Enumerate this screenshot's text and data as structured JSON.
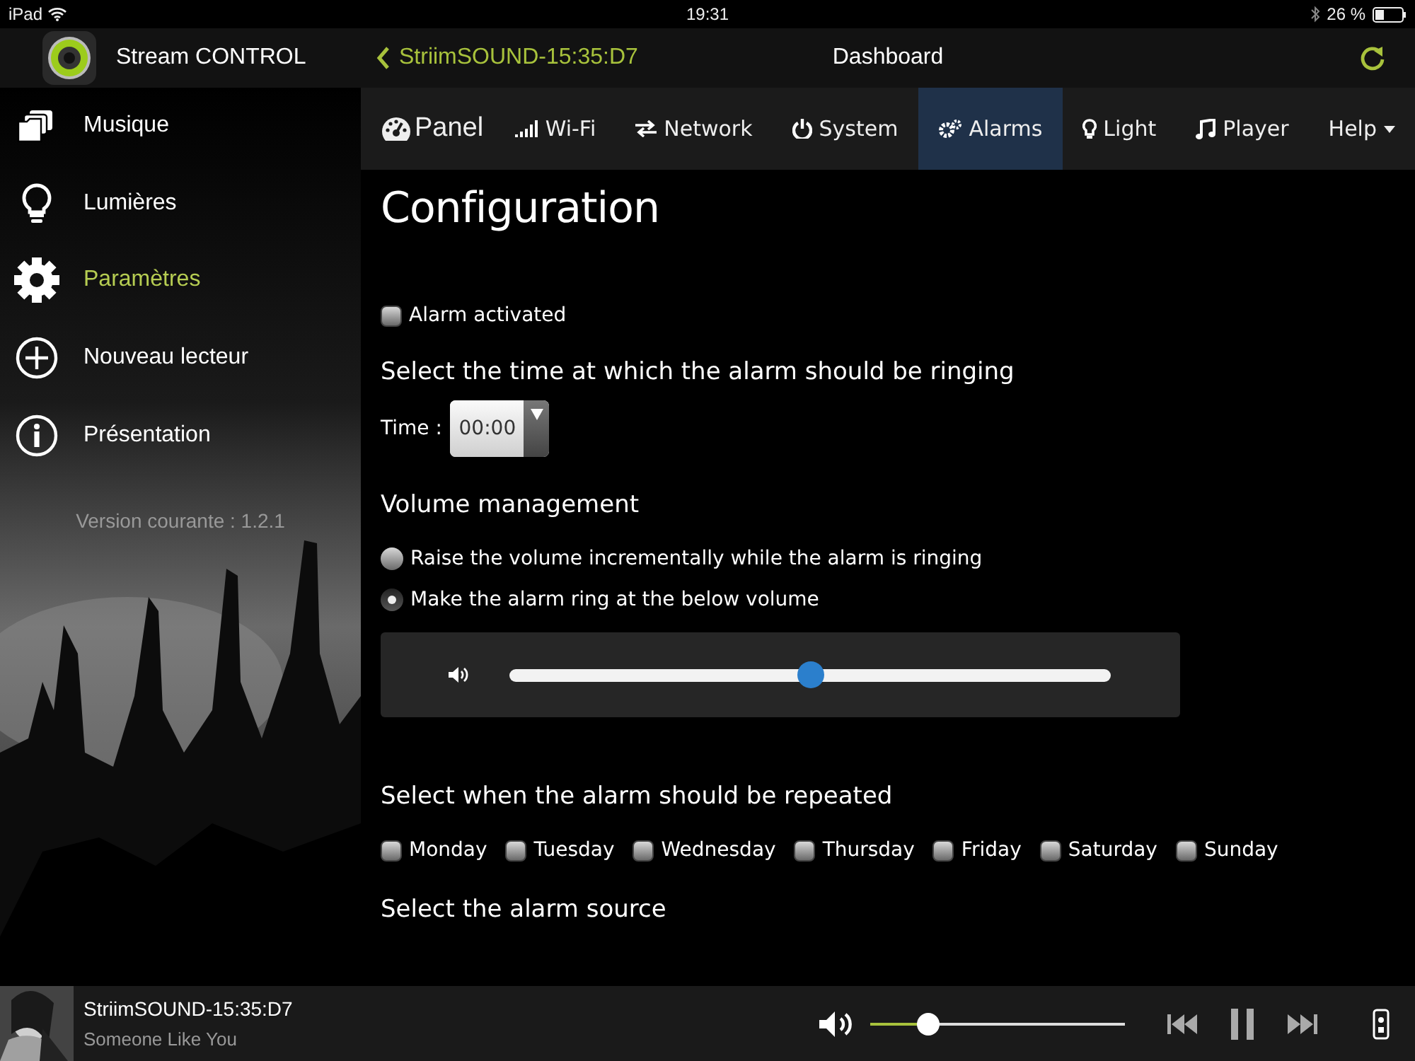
{
  "status_bar": {
    "device": "iPad",
    "time": "19:31",
    "battery": "26 %"
  },
  "app_header": {
    "app_name": "Stream CONTROL",
    "back_label": "StriimSOUND-15:35:D7",
    "title": "Dashboard"
  },
  "sidebar": {
    "items": [
      {
        "label": "Musique",
        "selected": false
      },
      {
        "label": "Lumières",
        "selected": false
      },
      {
        "label": "Paramètres",
        "selected": true
      },
      {
        "label": "Nouveau lecteur",
        "selected": false
      },
      {
        "label": "Présentation",
        "selected": false
      }
    ],
    "version": "Version courante : 1.2.1"
  },
  "navbar": {
    "brand": "Panel",
    "tabs": [
      {
        "label": "Wi-Fi",
        "selected": false,
        "kind": "link"
      },
      {
        "label": "Network",
        "selected": false,
        "kind": "link"
      },
      {
        "label": "System",
        "selected": false,
        "kind": "link"
      },
      {
        "label": "Alarms",
        "selected": true,
        "kind": "link"
      },
      {
        "label": "Light",
        "selected": false,
        "kind": "link"
      },
      {
        "label": "Player",
        "selected": false,
        "kind": "link"
      },
      {
        "label": "Help",
        "selected": false,
        "kind": "dropdown"
      }
    ]
  },
  "config": {
    "title": "Configuration",
    "alarm_activated": {
      "label": "Alarm activated",
      "checked": false
    },
    "time_heading": "Select the time at which the alarm should be ringing",
    "time_label": "Time :",
    "time_value": "00:00",
    "volume_heading": "Volume management",
    "volume_options": [
      {
        "label": "Raise the volume incrementally while the alarm is ringing",
        "selected": false
      },
      {
        "label": "Make the alarm ring at the below volume",
        "selected": true
      }
    ],
    "volume": {
      "level": 0.5
    },
    "repeat_heading": "Select when the alarm should be repeated",
    "days": [
      {
        "label": "Monday",
        "checked": false
      },
      {
        "label": "Tuesday",
        "checked": false
      },
      {
        "label": "Wednesday",
        "checked": false
      },
      {
        "label": "Thursday",
        "checked": false
      },
      {
        "label": "Friday",
        "checked": false
      },
      {
        "label": "Saturday",
        "checked": false
      },
      {
        "label": "Sunday",
        "checked": false
      }
    ],
    "source_heading": "Select the alarm source"
  },
  "player": {
    "title": "StriimSOUND-15:35:D7",
    "subtitle": "Someone Like You",
    "volume": {
      "level": 0.23
    }
  }
}
